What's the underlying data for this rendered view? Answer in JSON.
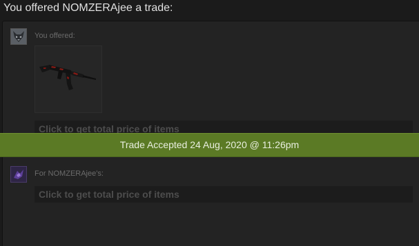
{
  "trade": {
    "heading": "You offered NOMZERAjee a trade:",
    "you": {
      "label": "You offered:",
      "price_prompt": "Click to get total price of items",
      "items": [
        {
          "icon": "rifle-icon"
        }
      ]
    },
    "them": {
      "label": "For NOMZERAjee's:",
      "price_prompt": "Click to get total price of items"
    },
    "status": "Trade Accepted 24 Aug, 2020 @ 11:26pm"
  },
  "colors": {
    "background": "#1b1b1b",
    "panel": "#232323",
    "accepted_banner": "#5b7a25",
    "muted_text": "#6b6b6b"
  }
}
